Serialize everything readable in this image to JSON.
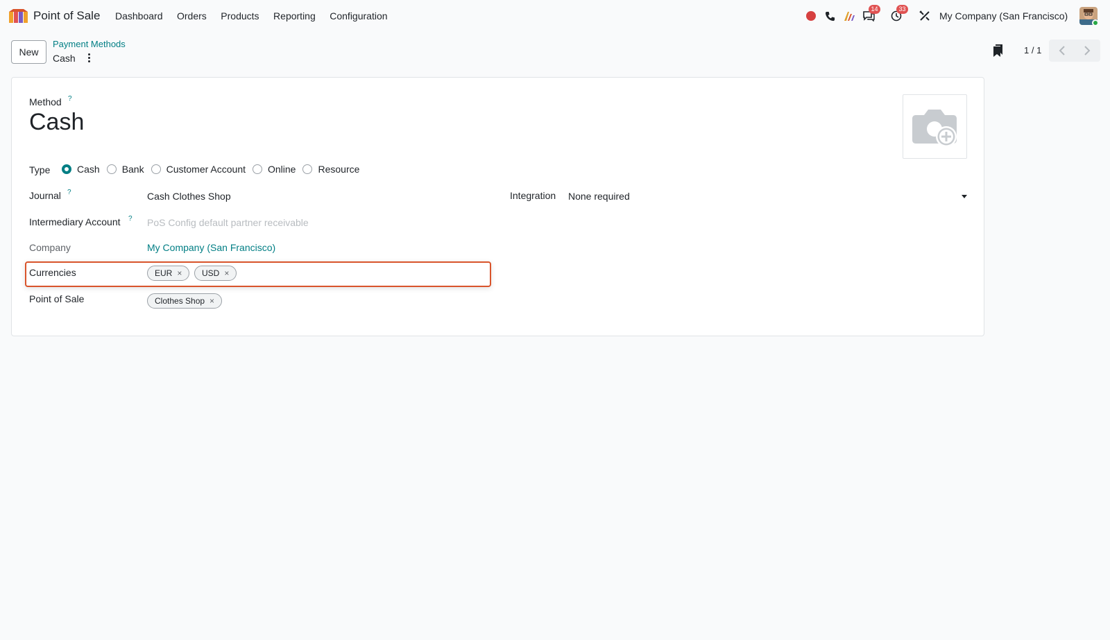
{
  "navbar": {
    "app_title": "Point of Sale",
    "menu": [
      "Dashboard",
      "Orders",
      "Products",
      "Reporting",
      "Configuration"
    ],
    "messages_badge": "14",
    "activities_badge": "33",
    "company": "My Company (San Francisco)"
  },
  "control_panel": {
    "new_label": "New",
    "breadcrumb": "Payment Methods",
    "record_name": "Cash",
    "pager": "1 / 1"
  },
  "form": {
    "method_label": "Method",
    "help_mark": "?",
    "method_name": "Cash",
    "type_label": "Type",
    "type_options": [
      "Cash",
      "Bank",
      "Customer Account",
      "Online",
      "Resource"
    ],
    "type_selected": "Cash",
    "journal_label": "Journal",
    "journal_value": "Cash Clothes Shop",
    "integration_label": "Integration",
    "integration_value": "None required",
    "intermediary_label": "Intermediary Account",
    "intermediary_placeholder": "PoS Config default partner receivable",
    "company_label": "Company",
    "company_value": "My Company (San Francisco)",
    "currencies_label": "Currencies",
    "currencies": [
      "EUR",
      "USD"
    ],
    "pos_label": "Point of Sale",
    "pos_values": [
      "Clothes Shop"
    ],
    "tag_remove": "×"
  },
  "colors": {
    "accent": "#017e84",
    "highlight": "#d9542b",
    "badge": "#e05252"
  }
}
